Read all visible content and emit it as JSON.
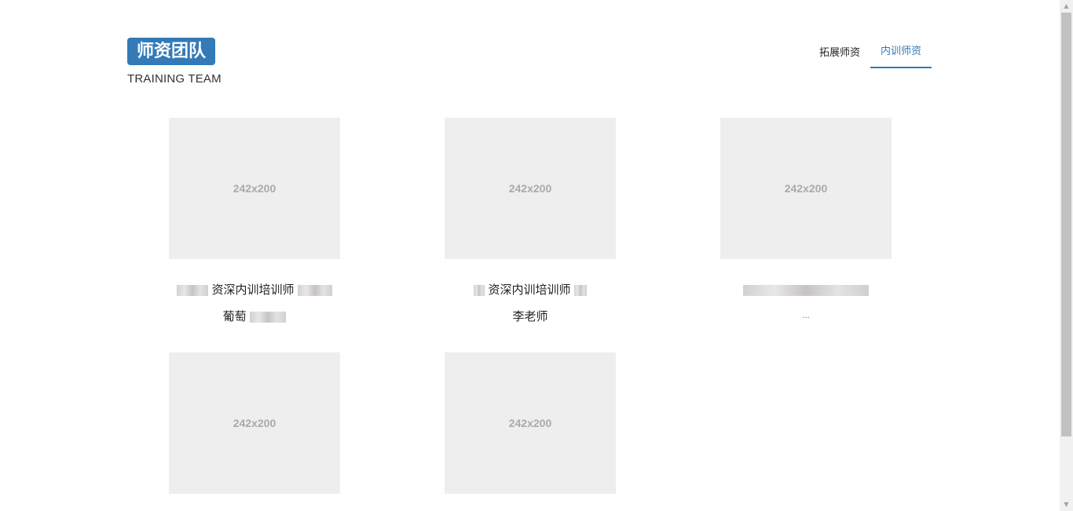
{
  "header": {
    "logo_text": "师资团队",
    "subtitle": "TRAINING TEAM"
  },
  "tabs": [
    {
      "label": "拓展师资",
      "active": false
    },
    {
      "label": "内训师资",
      "active": true
    }
  ],
  "cards": [
    {
      "placeholder": "242x200",
      "title": "资深内训培训师",
      "name": "葡萄"
    },
    {
      "placeholder": "242x200",
      "title": "资深内训培训师",
      "name": "李老师"
    },
    {
      "placeholder": "242x200",
      "title": "",
      "name": "..."
    },
    {
      "placeholder": "242x200",
      "title": "",
      "name": ""
    },
    {
      "placeholder": "242x200",
      "title": "",
      "name": ""
    }
  ],
  "colors": {
    "accent": "#337ab7",
    "placeholder_bg": "#eeeeee"
  },
  "icons": {
    "scroll_up": "chevron-up-icon",
    "scroll_down": "chevron-down-icon"
  }
}
